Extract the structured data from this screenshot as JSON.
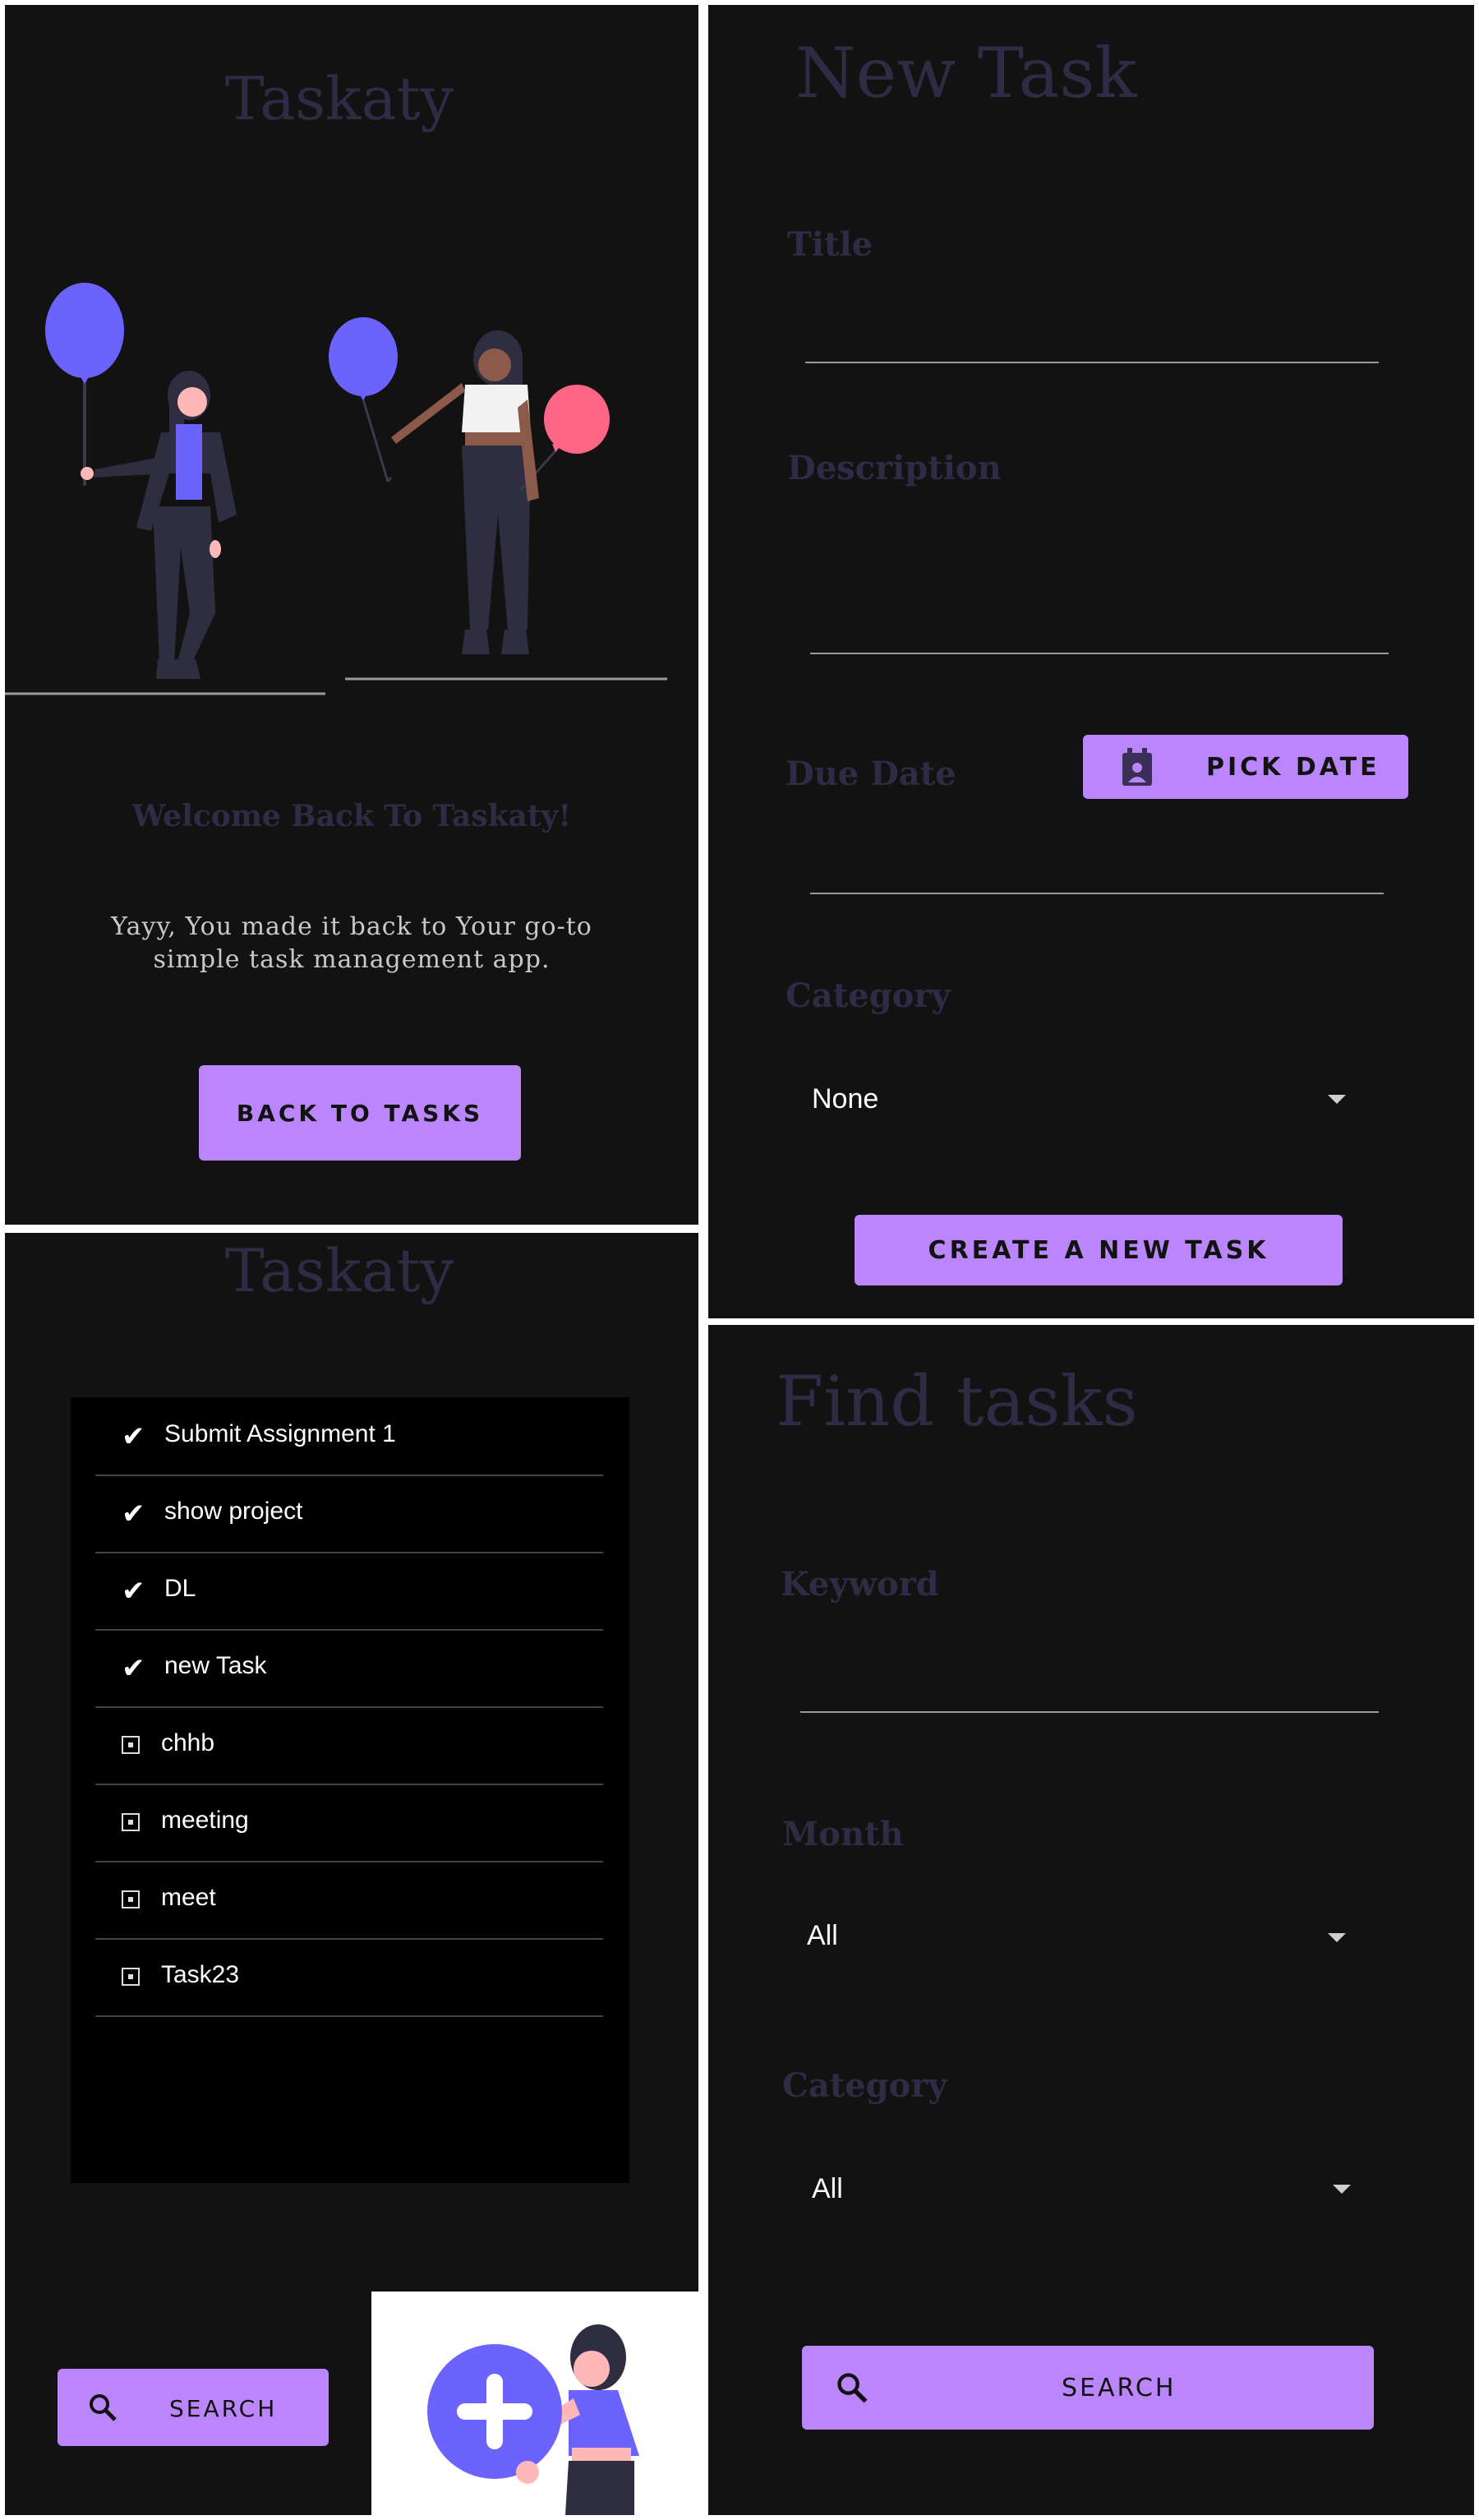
{
  "welcome_screen": {
    "app_title": "Taskaty",
    "heading": "Welcome Back To Taskaty!",
    "message_line1": "Yayy, You made it back to Your go-to",
    "message_line2": "simple task management app.",
    "back_button": "BACK TO TASKS"
  },
  "new_task_screen": {
    "title": "New Task",
    "title_label": "Title",
    "description_label": "Description",
    "due_date_label": "Due Date",
    "pick_date_button": "PICK DATE",
    "category_label": "Category",
    "category_value": "None",
    "create_button": "CREATE A NEW TASK"
  },
  "task_list_screen": {
    "app_title": "Taskaty",
    "tasks": [
      {
        "label": "Submit Assignment 1",
        "done": true
      },
      {
        "label": "show project",
        "done": true
      },
      {
        "label": "DL",
        "done": true
      },
      {
        "label": "new Task",
        "done": true
      },
      {
        "label": "chhb",
        "done": false
      },
      {
        "label": "meeting",
        "done": false
      },
      {
        "label": "meet",
        "done": false
      },
      {
        "label": "Task23",
        "done": false
      }
    ],
    "search_button": "SEARCH",
    "done_mark": "✔"
  },
  "find_screen": {
    "title": "Find tasks",
    "keyword_label": "Keyword",
    "month_label": "Month",
    "month_value": "All",
    "category_label": "Category",
    "category_value": "All",
    "search_button": "SEARCH"
  },
  "colors": {
    "background": "#121212",
    "accent": "#bb86fc",
    "dim_text": "#2e2b44",
    "balloon_blue": "#6c63ff",
    "balloon_pink": "#ff6584"
  }
}
